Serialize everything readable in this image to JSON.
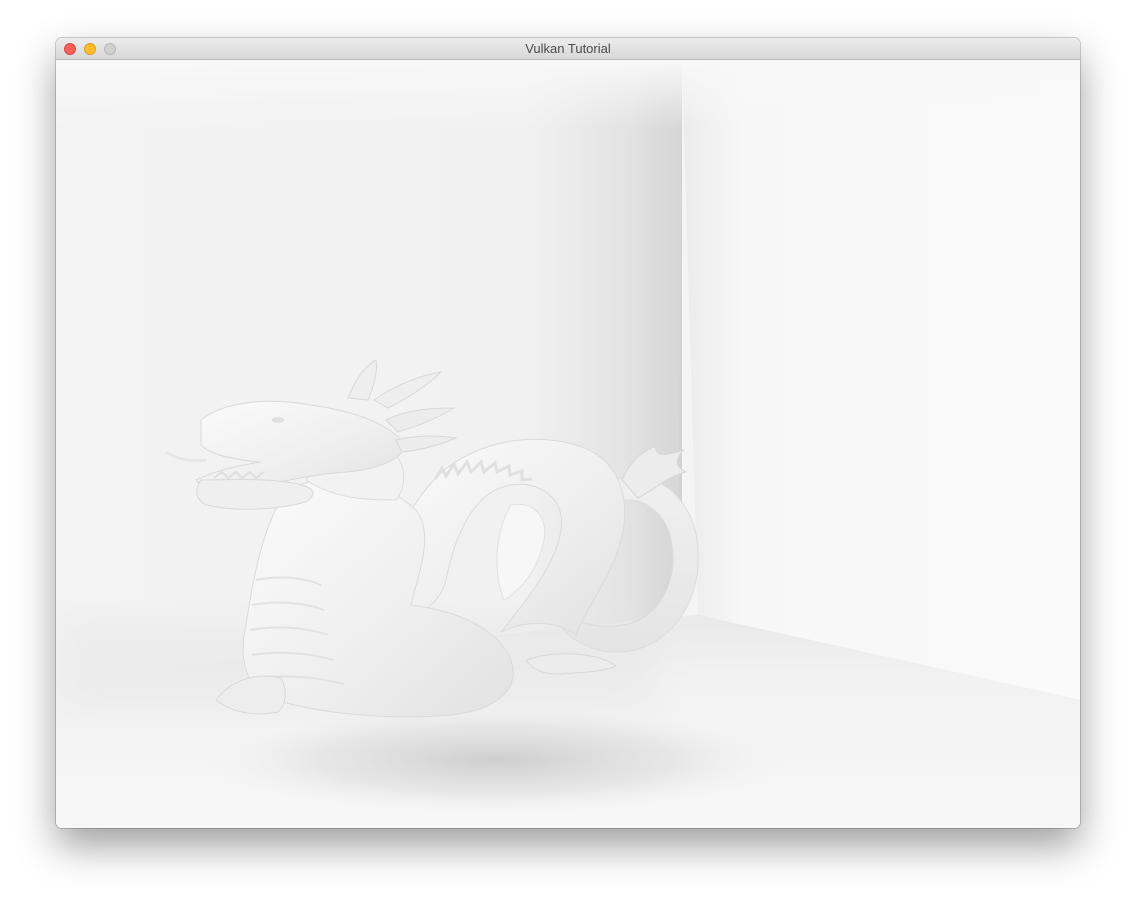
{
  "window": {
    "title": "Vulkan Tutorial"
  },
  "controls": {
    "close_icon": "close-icon",
    "minimize_icon": "minimize-icon",
    "zoom_icon": "zoom-icon",
    "close_color": "#fc5f57",
    "minimize_color": "#fdbb2e",
    "zoom_color": "#d0d0d0"
  },
  "scene": {
    "background_color": "#f6f6f6",
    "model": "dragon"
  }
}
